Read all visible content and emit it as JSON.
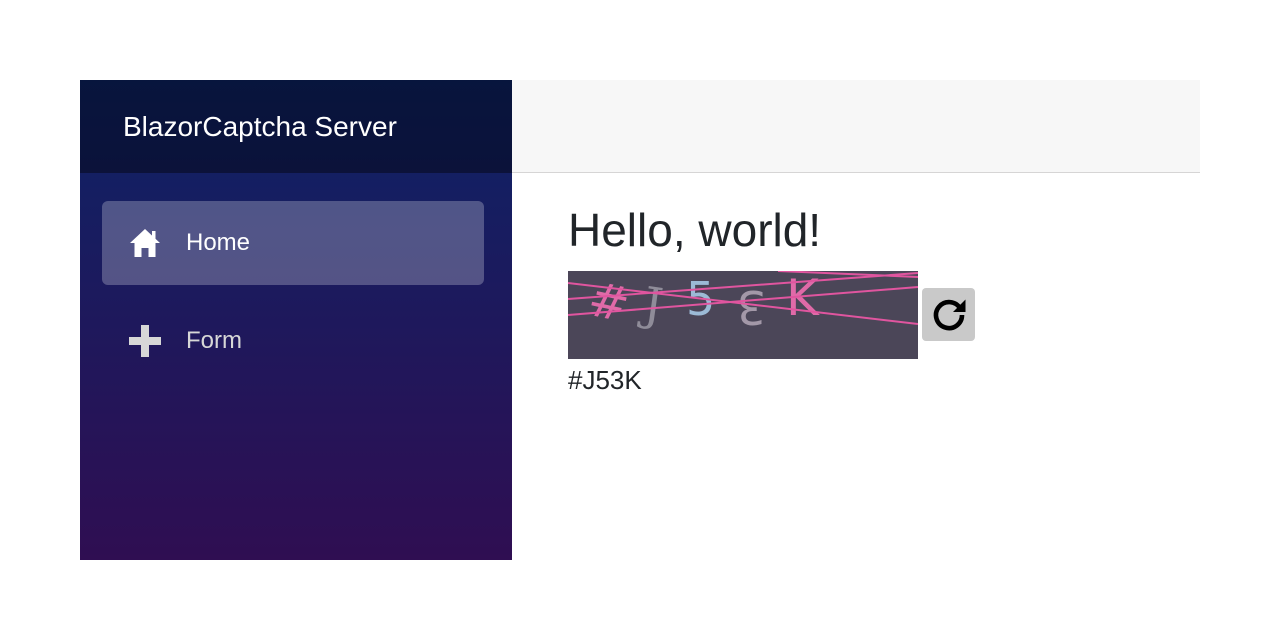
{
  "sidebar": {
    "brand": "BlazorCaptcha Server",
    "items": [
      {
        "label": "Home",
        "icon": "home-icon",
        "active": true
      },
      {
        "label": "Form",
        "icon": "plus-icon",
        "active": false
      }
    ]
  },
  "main": {
    "title": "Hello, world!",
    "captcha": {
      "characters": [
        "#",
        "J",
        "5",
        "3",
        "K"
      ],
      "code": "#J53K",
      "refresh_icon": "refresh-icon"
    }
  },
  "colors": {
    "sidebar_top": "#0d2366",
    "sidebar_bottom": "#2f0e52",
    "captcha_background": "#4b4658",
    "captcha_noise_line": "#e0559f",
    "refresh_button": "#c9c9c9"
  }
}
